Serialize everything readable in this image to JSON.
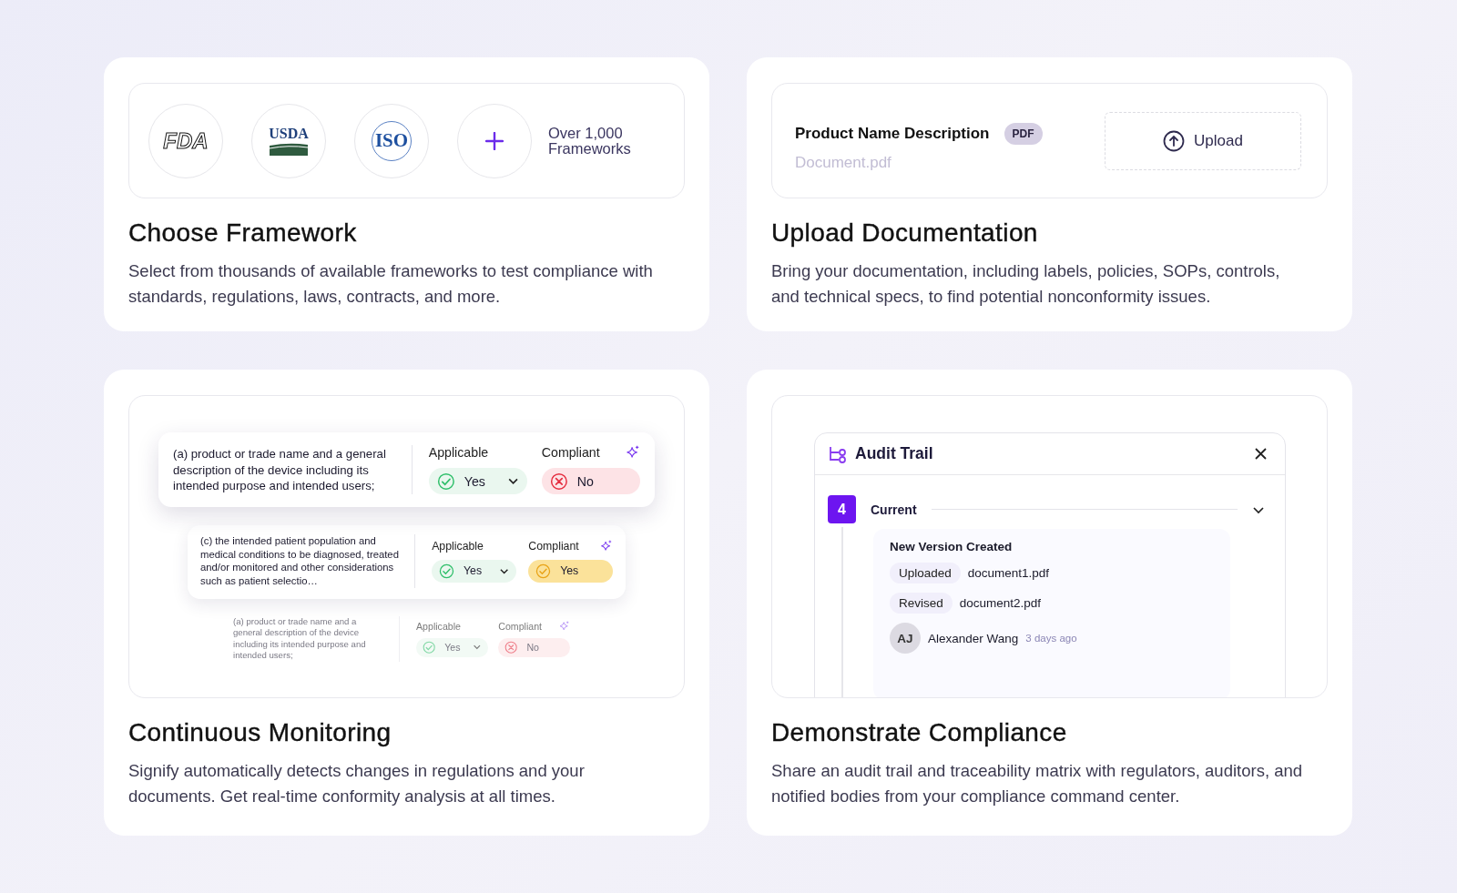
{
  "cards": [
    {
      "kind": "frameworks",
      "title": "Choose Framework",
      "description": "Select from thousands of available frameworks to test compliance with standards, regulations, laws, contracts, and more.",
      "logos": [
        {
          "kind": "fda",
          "text": "FDA"
        },
        {
          "kind": "usda",
          "text": "USDA"
        },
        {
          "kind": "iso",
          "text": "ISO"
        }
      ],
      "more_label": "Over 1,000 Frameworks"
    },
    {
      "kind": "upload",
      "title": "Upload Documentation",
      "description": "Bring your documentation, including labels, policies, SOPs, controls, and technical specs, to find potential nonconformity issues.",
      "document": {
        "name": "Product Name Description",
        "badge": "PDF",
        "file": "Document.pdf"
      },
      "upload_button": "Upload"
    },
    {
      "kind": "monitoring",
      "title": "Continuous Monitoring",
      "description": "Signify automatically detects changes in regulations and your documents. Get real-time conformity analysis at all times.",
      "clauses": [
        {
          "text": "(a) product or trade name and a general description of the device including its intended purpose and intended users;",
          "applicable_label": "Applicable",
          "applicable": {
            "value": "Yes",
            "kind": "pass"
          },
          "compliant_label": "Compliant",
          "compliant": {
            "value": "No",
            "kind": "fail"
          }
        },
        {
          "text": "(c) the intended patient population and medical conditions to be diagnosed, treated and/or monitored and other considerations such as patient selectio…",
          "applicable_label": "Applicable",
          "applicable": {
            "value": "Yes",
            "kind": "pass"
          },
          "compliant_label": "Compliant",
          "compliant": {
            "value": "Yes",
            "kind": "warning"
          }
        },
        {
          "text": "(a) product or trade name and a general description of the device including its intended purpose and intended users;",
          "applicable_label": "Applicable",
          "applicable": {
            "value": "Yes",
            "kind": "pass"
          },
          "compliant_label": "Compliant",
          "compliant": {
            "value": "No",
            "kind": "fail"
          }
        }
      ]
    },
    {
      "kind": "audit",
      "title": "Demonstrate Compliance",
      "description": "Share an audit trail and traceability matrix with regulators, auditors, and notified bodies from your compliance command center.",
      "panel": {
        "title": "Audit Trail",
        "version": {
          "number": "4",
          "label": "Current",
          "expanded": true
        },
        "event": {
          "title": "New Version Created",
          "entries": [
            {
              "tag": "Uploaded",
              "file": "document1.pdf"
            },
            {
              "tag": "Revised",
              "file": "document2.pdf"
            }
          ],
          "user": {
            "initials": "AJ",
            "name": "Alexander Wang",
            "time": "3 days ago"
          }
        }
      }
    }
  ]
}
